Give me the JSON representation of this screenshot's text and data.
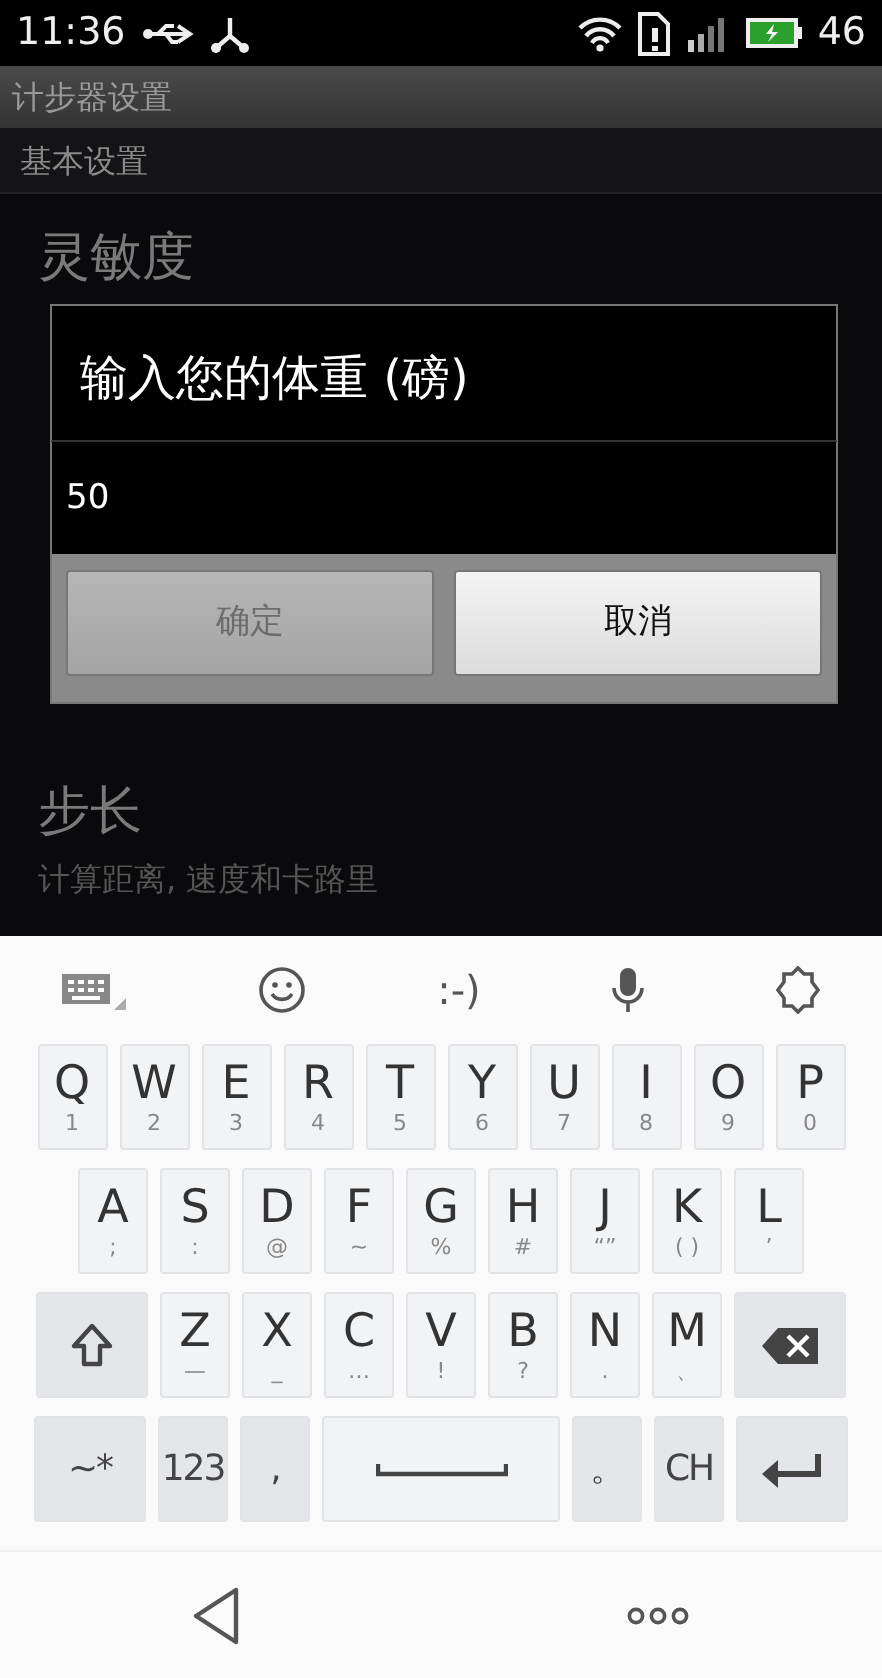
{
  "status_bar": {
    "time": "11:36",
    "battery": "46"
  },
  "title": "计步器设置",
  "section": "基本设置",
  "settings": [
    {
      "title": "灵敏度"
    },
    {
      "title": "步长",
      "subtitle": "计算距离, 速度和卡路里"
    }
  ],
  "dialog": {
    "title": "输入您的体重 (磅)",
    "value": "50",
    "buttons": [
      {
        "label": "确定",
        "disabled": true
      },
      {
        "label": "取消",
        "disabled": false
      }
    ]
  },
  "keyboard": {
    "toolbar_text": ":-)",
    "rows": [
      {
        "keys": [
          {
            "kind": "letter",
            "label": "Q",
            "sub": "1"
          },
          {
            "kind": "letter",
            "label": "W",
            "sub": "2"
          },
          {
            "kind": "letter",
            "label": "E",
            "sub": "3"
          },
          {
            "kind": "letter",
            "label": "R",
            "sub": "4"
          },
          {
            "kind": "letter",
            "label": "T",
            "sub": "5"
          },
          {
            "kind": "letter",
            "label": "Y",
            "sub": "6"
          },
          {
            "kind": "letter",
            "label": "U",
            "sub": "7"
          },
          {
            "kind": "letter",
            "label": "I",
            "sub": "8"
          },
          {
            "kind": "letter",
            "label": "O",
            "sub": "9"
          },
          {
            "kind": "letter",
            "label": "P",
            "sub": "0"
          }
        ]
      },
      {
        "keys": [
          {
            "kind": "letter",
            "label": "A",
            "sub": ";"
          },
          {
            "kind": "letter",
            "label": "S",
            "sub": ":"
          },
          {
            "kind": "letter",
            "label": "D",
            "sub": "@"
          },
          {
            "kind": "letter",
            "label": "F",
            "sub": "~"
          },
          {
            "kind": "letter",
            "label": "G",
            "sub": "%"
          },
          {
            "kind": "letter",
            "label": "H",
            "sub": "#"
          },
          {
            "kind": "letter",
            "label": "J",
            "sub": "“”"
          },
          {
            "kind": "letter",
            "label": "K",
            "sub": "( )"
          },
          {
            "kind": "letter",
            "label": "L",
            "sub": "’"
          }
        ]
      },
      {
        "keys": [
          {
            "kind": "shift"
          },
          {
            "kind": "letter",
            "label": "Z",
            "sub": "—"
          },
          {
            "kind": "letter",
            "label": "X",
            "sub": "_"
          },
          {
            "kind": "letter",
            "label": "C",
            "sub": "…"
          },
          {
            "kind": "letter",
            "label": "V",
            "sub": "!"
          },
          {
            "kind": "letter",
            "label": "B",
            "sub": "?"
          },
          {
            "kind": "letter",
            "label": "N",
            "sub": "."
          },
          {
            "kind": "letter",
            "label": "M",
            "sub": "、"
          },
          {
            "kind": "backspace"
          }
        ]
      },
      {
        "keys": [
          {
            "kind": "function",
            "label": "~*"
          },
          {
            "kind": "function",
            "label": "123"
          },
          {
            "kind": "function",
            "label": ","
          },
          {
            "kind": "space"
          },
          {
            "kind": "function",
            "label": "。"
          },
          {
            "kind": "function",
            "label": "CH"
          },
          {
            "kind": "enter"
          }
        ]
      }
    ]
  }
}
